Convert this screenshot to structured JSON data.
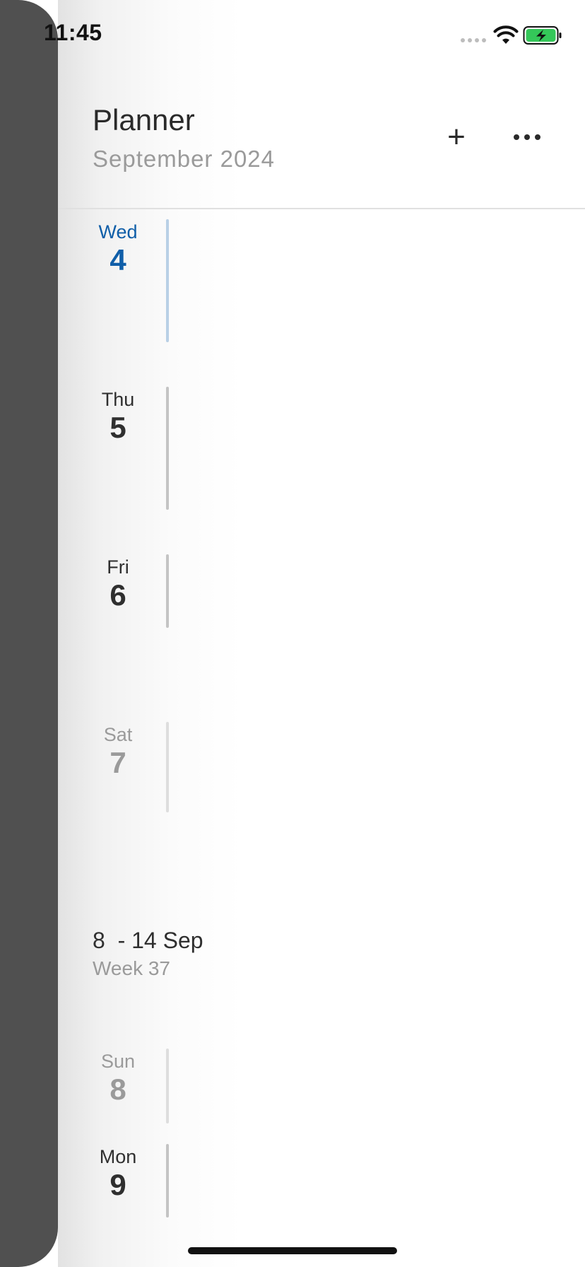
{
  "status_bar": {
    "time": "11:45"
  },
  "header": {
    "title": "Planner",
    "subtitle": "September 2024",
    "add_label": "+"
  },
  "days_first_week": [
    {
      "dow": "Wed",
      "num": "4",
      "state": "today"
    },
    {
      "dow": "Thu",
      "num": "5",
      "state": "normal"
    },
    {
      "dow": "Fri",
      "num": "6",
      "state": "normal"
    },
    {
      "dow": "Sat",
      "num": "7",
      "state": "weekend"
    }
  ],
  "week": {
    "range": "8  - 14 Sep",
    "label": "Week 37"
  },
  "days_second_week": [
    {
      "dow": "Sun",
      "num": "8",
      "state": "weekend"
    },
    {
      "dow": "Mon",
      "num": "9",
      "state": "normal"
    }
  ],
  "colors": {
    "today_accent": "#0f5ea8",
    "side_panel": "#505050",
    "battery_green": "#34c759"
  }
}
